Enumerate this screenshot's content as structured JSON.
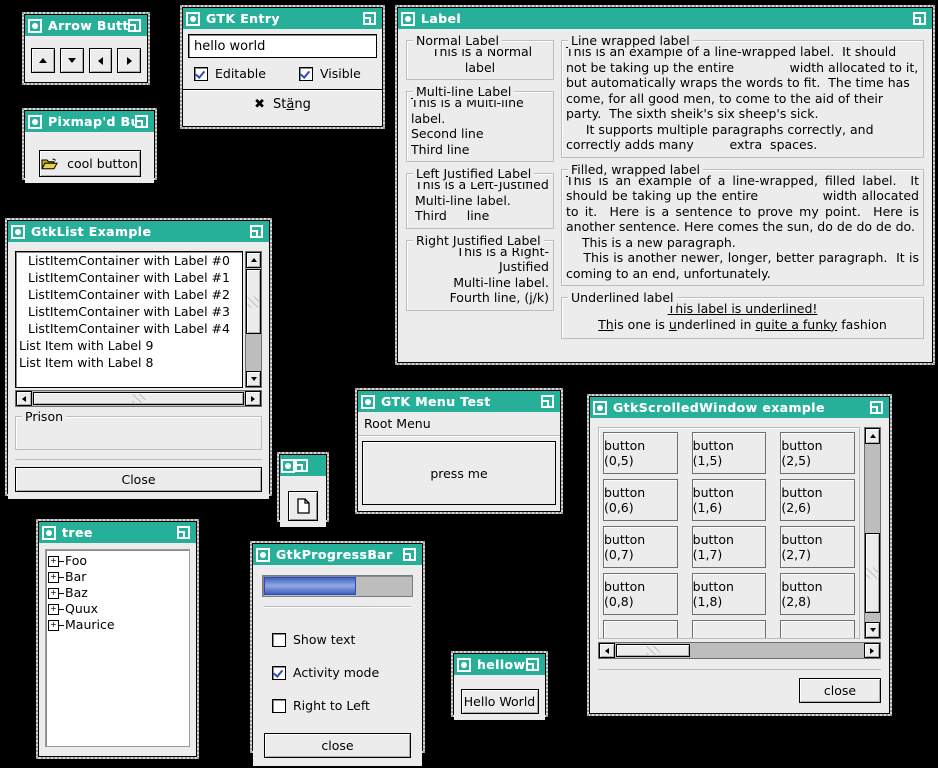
{
  "windows": {
    "arrow": {
      "title": "Arrow Buttons",
      "buttons": [
        {
          "name": "up",
          "glyph": "up"
        },
        {
          "name": "down",
          "glyph": "down"
        },
        {
          "name": "left",
          "glyph": "left"
        },
        {
          "name": "right",
          "glyph": "right"
        }
      ]
    },
    "pixmap": {
      "title": "Pixmap'd Butto",
      "button_label": "cool button",
      "icon": "open-folder-icon"
    },
    "entry": {
      "title": "GTK Entry",
      "value": "hello world",
      "placeholder": "",
      "editable_label": "Editable",
      "editable_checked": true,
      "visible_label": "Visible",
      "visible_checked": true,
      "close_prefix": "St",
      "close_mnemonic": "ä",
      "close_suffix": "ng",
      "close_label": "Stäng",
      "close_icon": "cross-icon"
    },
    "label": {
      "title": "Label",
      "normal": {
        "legend": "Normal Label",
        "text": " This is a Normal label"
      },
      "multiline": {
        "legend": "Multi-line Label",
        "text": "This is a Multi-line label.\nSecond line\nThird line"
      },
      "left_justified": {
        "legend": "Left Justified Label",
        "text": " This is a Left-Justified\n Multi-line label.\n Third     line"
      },
      "right_justified": {
        "legend": "Right Justified Label",
        "text": "This is a Right-Justified\nMulti-line label.\nFourth line, (j/k)"
      },
      "line_wrapped": {
        "legend": "Line wrapped label",
        "text": "This is an example of a line-wrapped label.  It should not be taking up the entire              width allocated to it, but automatically wraps the words to fit.  The time has come, for all good men, to come to the aid of their party.  The sixth sheik's six sheep's sick.\n     It supports multiple paragraphs correctly, and  correctly adds many         extra  spaces."
      },
      "filled_wrapped": {
        "legend": "Filled, wrapped label",
        "text": "This is an example of a line-wrapped, filled label.  It should be taking up the entire              width allocated to it.  Here is a sentence to prove my point.  Here is another sentence. Here comes the sun, do de do de do.\n    This is a new paragraph.\n    This is another newer, longer, better paragraph.  It is coming to an end, unfortunately."
      },
      "underlined": {
        "legend": "Underlined label",
        "line1": "This label is underlined!",
        "line2_parts": [
          {
            "t": "Th",
            "u": true
          },
          {
            "t": "is one is ",
            "u": false
          },
          {
            "t": "u",
            "u": true
          },
          {
            "t": "nderlined",
            "u": false
          },
          {
            "t": " in ",
            "u": false
          },
          {
            "t": "quite a funky",
            "u": true
          },
          {
            "t": " fashion",
            "u": false
          }
        ],
        "line2_plain": "This one is underlined in quite a funky fashion"
      }
    },
    "gtklist": {
      "title": "GtkList Example",
      "items": [
        {
          "text": "ListItemContainer with Label #0",
          "indented": true
        },
        {
          "text": "ListItemContainer with Label #1",
          "indented": true
        },
        {
          "text": "ListItemContainer with Label #2",
          "indented": true
        },
        {
          "text": "ListItemContainer with Label #3",
          "indented": true
        },
        {
          "text": "ListItemContainer with Label #4",
          "indented": true
        },
        {
          "text": "List Item with Label 9",
          "indented": false
        },
        {
          "text": "List Item with Label 8",
          "indented": false
        }
      ],
      "prison_legend": "Prison",
      "close_label": "Close"
    },
    "tree": {
      "title": "tree",
      "nodes": [
        "Foo",
        "Bar",
        "Baz",
        "Quux",
        "Maurice"
      ],
      "expander_glyph": "+"
    },
    "progress": {
      "title": "GtkProgressBar",
      "value_percent": 62,
      "show_text_label": "Show text",
      "show_text_checked": false,
      "activity_mode_label": "Activity mode",
      "activity_mode_checked": true,
      "rtl_label": "Right to Left",
      "rtl_checked": false,
      "close_label": "close"
    },
    "menu": {
      "title": "GTK Menu Test",
      "root_menu_label": "Root Menu",
      "press_label": "press me"
    },
    "tiny": {
      "title": "",
      "button_icon": "document-icon"
    },
    "hello": {
      "title": "helloworld",
      "button_label": "Hello World"
    },
    "scrolled": {
      "title": "GtkScrolledWindow example",
      "rows": [
        [
          "button (0,5)",
          "button (1,5)",
          "button (2,5)"
        ],
        [
          "button (0,6)",
          "button (1,6)",
          "button (2,6)"
        ],
        [
          "button (0,7)",
          "button (1,7)",
          "button (2,7)"
        ],
        [
          "button (0,8)",
          "button (1,8)",
          "button (2,8)"
        ]
      ],
      "close_label": "close"
    }
  },
  "colors": {
    "titlebar": "#26b09a",
    "titlebar_text": "#ffffff",
    "window_bg": "#ececec",
    "progress_fill": "#4364c4",
    "desktop": "#000000"
  }
}
